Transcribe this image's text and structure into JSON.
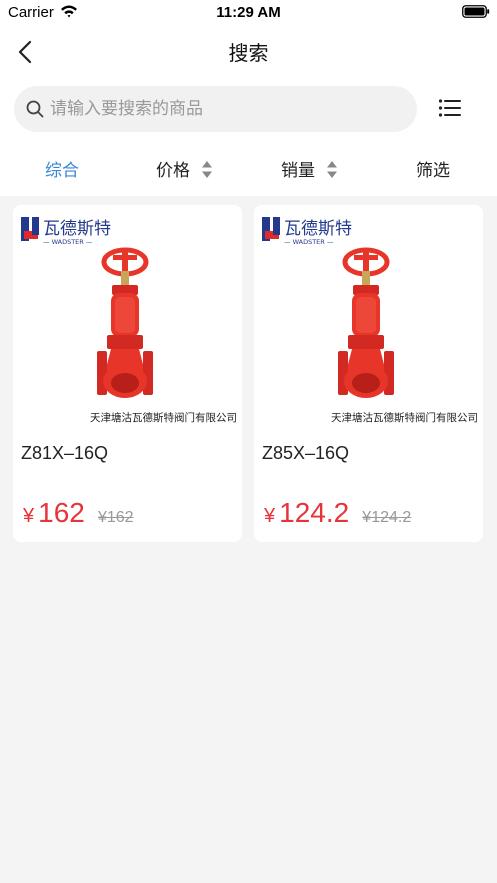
{
  "status_bar": {
    "carrier": "Carrier",
    "time": "11:29 AM"
  },
  "nav": {
    "title": "搜索"
  },
  "search": {
    "placeholder": "请输入要搜索的商品",
    "value": ""
  },
  "filters": [
    {
      "label": "综合",
      "active": true
    },
    {
      "label": "价格",
      "sortable": true
    },
    {
      "label": "销量",
      "sortable": true
    },
    {
      "label": "筛选"
    }
  ],
  "products": [
    {
      "name": "Z81X–16Q",
      "currency_symbol": "¥",
      "price": "162",
      "original_price": "¥162",
      "brand_cn": "瓦德斯特",
      "brand_en": "— WADSTER —",
      "company": "天津塘沽瓦德斯特阀门有限公司"
    },
    {
      "name": "Z85X–16Q",
      "currency_symbol": "¥",
      "price": "124.2",
      "original_price": "¥124.2",
      "brand_cn": "瓦德斯特",
      "brand_en": "— WADSTER —",
      "company": "天津塘沽瓦德斯特阀门有限公司"
    }
  ],
  "colors": {
    "accent": "#3a86d6",
    "price": "#e7333a",
    "valve": "#e8352a",
    "brand_blue": "#233a8c",
    "brand_red": "#e02a2a"
  }
}
